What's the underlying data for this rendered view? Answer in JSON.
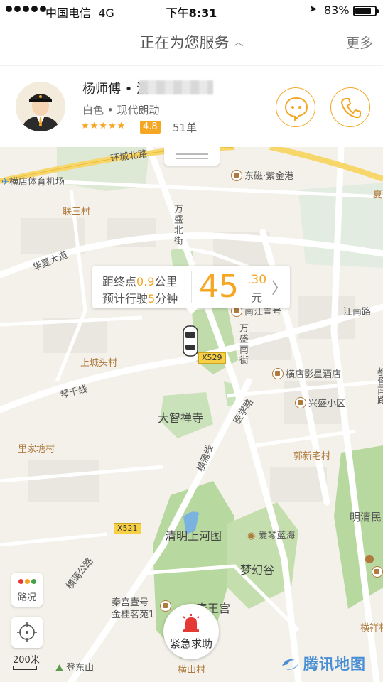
{
  "status_bar": {
    "carrier": "中国电信",
    "network": "4G",
    "time": "下午8:31",
    "battery_percent": "83%",
    "battery_level": 0.83
  },
  "nav": {
    "title": "正在为您服务",
    "more_label": "更多",
    "chevron_icon": "chevron-up-icon"
  },
  "driver": {
    "name": "杨师傅",
    "separator": "•",
    "plate_prefix": "浙",
    "car": "白色 • 现代朗动",
    "rating_stars": "★★★★★",
    "rating": "4.8",
    "orders": "51单",
    "message_icon": "chat-bubble-icon",
    "call_icon": "phone-icon",
    "accent": "#f5a623"
  },
  "trip": {
    "distance_prefix": "距终点",
    "distance_value": "0.9",
    "distance_unit": "公里",
    "time_prefix": "预计行驶",
    "time_value": "5",
    "time_unit": "分钟",
    "fare_integer": "45",
    "fare_decimal": ".30",
    "fare_unit": "元"
  },
  "map": {
    "labels": {
      "huancheng": "环城北路",
      "airport": "横店体育机场",
      "dongci": "东磁·紫金港",
      "xia": "夏",
      "liansan": "联三村",
      "wansheng_north": "万盛北街",
      "huaxia": "华夏大道",
      "nanjiang": "南江壹号",
      "jiangnan": "江南路",
      "shangchengtou": "上城头村",
      "wansheng_south": "万盛南街",
      "yingxing": "横店影星酒店",
      "qianxian": "琴千线",
      "xingsheng": "兴盛小区",
      "dazhi": "大智禅寺",
      "yixue": "医学路",
      "lijiatang": "里家塘村",
      "hengpu": "横蒲线",
      "guoxin": "郭新宅村",
      "mingqing": "明清民",
      "qingming": "清明上河图",
      "aiqin": "爱琴蓝海",
      "hengpu_road": "横蒲公路",
      "menghuan": "梦幻谷",
      "qingong1": "秦宫壹号",
      "qingong2": "金桂茗苑1",
      "qinwang": "秦王宫",
      "hengxiang": "横祥村",
      "dengdong": "登东山",
      "hengshan": "横山村",
      "east_road": "都督南路"
    },
    "road_tags": {
      "x529": "X529",
      "x521": "X521"
    },
    "traffic_label": "路况",
    "traffic_colors": [
      "#e53935",
      "#f5a623",
      "#43a047"
    ],
    "scale_label": "200米",
    "sos_label": "紧急求助",
    "sos_icon": "siren-icon",
    "locate_icon": "crosshair-icon",
    "brand": "腾讯地图"
  }
}
